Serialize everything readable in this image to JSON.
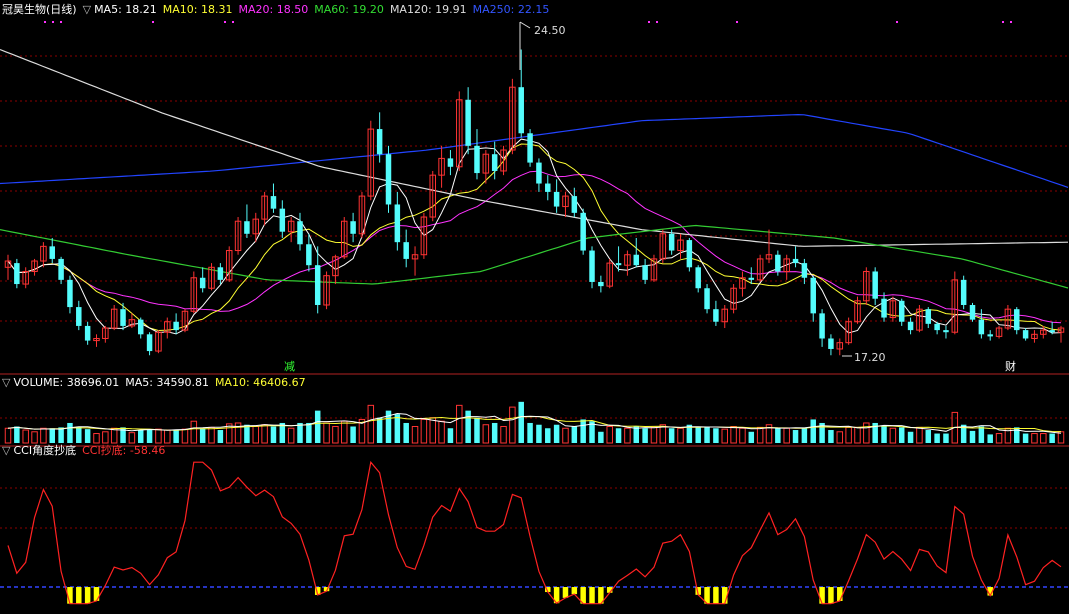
{
  "main": {
    "stock_name": "冠昊生物(日线)",
    "ma_labels": [
      {
        "text": "MA5: 18.21",
        "color": "#ffffff"
      },
      {
        "text": "MA10: 18.31",
        "color": "#ffff33"
      },
      {
        "text": "MA20: 18.50",
        "color": "#ff33ff"
      },
      {
        "text": "MA60: 19.20",
        "color": "#33dd33"
      },
      {
        "text": "MA120: 19.91",
        "color": "#dddddd"
      },
      {
        "text": "MA250: 22.15",
        "color": "#3355ff"
      }
    ],
    "high_label": "24.50",
    "low_label": "17.20",
    "marker_reduce": "减",
    "marker_finance": "财"
  },
  "volume": {
    "title": "VOLUME: 38696.01",
    "ma5": "MA5: 34590.81",
    "ma10": "MA10: 46406.67"
  },
  "cci": {
    "title": "CCI角度抄底",
    "value": "CCI抄底: -58.46"
  },
  "colors": {
    "up": "#ff3333",
    "down": "#54fcfc",
    "ma5": "#ffffff",
    "ma10": "#ffff33",
    "ma20": "#ff33ff",
    "ma60": "#33cc33",
    "ma120": "#dddddd",
    "ma250": "#2244ff",
    "cci_line": "#ff2222",
    "signal": "#ffff00",
    "grid": "#8b0000",
    "baseline": "#3344ff"
  },
  "chart_data": {
    "type": "candlestick",
    "price_range": [
      16.8,
      25.3
    ],
    "candles": [
      [
        19.3,
        19.6,
        19.0,
        19.45
      ],
      [
        19.4,
        19.5,
        18.8,
        18.9
      ],
      [
        18.9,
        19.3,
        18.8,
        19.2
      ],
      [
        19.2,
        19.5,
        19.1,
        19.45
      ],
      [
        19.45,
        19.9,
        19.3,
        19.8
      ],
      [
        19.8,
        20.0,
        19.4,
        19.5
      ],
      [
        19.5,
        19.55,
        18.9,
        19.0
      ],
      [
        19.0,
        19.1,
        18.2,
        18.35
      ],
      [
        18.35,
        18.5,
        17.8,
        17.9
      ],
      [
        17.9,
        18.0,
        17.45,
        17.55
      ],
      [
        17.55,
        17.7,
        17.4,
        17.6
      ],
      [
        17.6,
        17.9,
        17.5,
        17.85
      ],
      [
        17.85,
        18.4,
        17.8,
        18.3
      ],
      [
        18.3,
        18.45,
        17.8,
        17.9
      ],
      [
        17.9,
        18.2,
        17.85,
        18.05
      ],
      [
        18.05,
        18.1,
        17.6,
        17.7
      ],
      [
        17.7,
        17.75,
        17.2,
        17.3
      ],
      [
        17.3,
        17.8,
        17.25,
        17.75
      ],
      [
        17.75,
        18.1,
        17.6,
        18.0
      ],
      [
        18.0,
        18.2,
        17.7,
        17.8
      ],
      [
        17.8,
        18.3,
        17.75,
        18.25
      ],
      [
        18.25,
        19.2,
        18.2,
        19.05
      ],
      [
        19.05,
        19.3,
        18.7,
        18.8
      ],
      [
        18.8,
        19.4,
        18.75,
        19.3
      ],
      [
        19.3,
        19.4,
        18.9,
        19.0
      ],
      [
        19.0,
        19.8,
        18.95,
        19.7
      ],
      [
        19.7,
        20.5,
        19.6,
        20.4
      ],
      [
        20.4,
        20.8,
        20.0,
        20.1
      ],
      [
        20.1,
        20.6,
        19.9,
        20.45
      ],
      [
        20.45,
        21.1,
        20.3,
        21.0
      ],
      [
        21.0,
        21.3,
        20.6,
        20.7
      ],
      [
        20.7,
        20.9,
        20.0,
        20.15
      ],
      [
        20.15,
        20.5,
        19.9,
        20.4
      ],
      [
        20.4,
        20.6,
        19.7,
        19.85
      ],
      [
        19.85,
        20.1,
        19.2,
        19.35
      ],
      [
        19.35,
        19.8,
        18.2,
        18.4
      ],
      [
        18.4,
        19.2,
        18.3,
        19.1
      ],
      [
        19.1,
        19.6,
        18.9,
        19.55
      ],
      [
        19.55,
        20.5,
        19.5,
        20.4
      ],
      [
        20.4,
        20.6,
        19.9,
        20.1
      ],
      [
        20.1,
        21.1,
        20.0,
        21.0
      ],
      [
        21.0,
        22.8,
        20.9,
        22.6
      ],
      [
        22.6,
        23.0,
        21.8,
        22.0
      ],
      [
        22.0,
        22.2,
        20.6,
        20.8
      ],
      [
        20.8,
        21.1,
        19.7,
        19.9
      ],
      [
        19.9,
        20.2,
        19.3,
        19.5
      ],
      [
        19.5,
        19.8,
        19.1,
        19.6
      ],
      [
        19.6,
        20.6,
        19.5,
        20.5
      ],
      [
        20.5,
        21.6,
        20.4,
        21.5
      ],
      [
        21.5,
        22.2,
        21.2,
        21.9
      ],
      [
        21.9,
        22.1,
        21.5,
        21.7
      ],
      [
        21.7,
        23.5,
        21.6,
        23.3
      ],
      [
        23.3,
        23.6,
        22.0,
        22.2
      ],
      [
        22.2,
        22.6,
        21.4,
        21.55
      ],
      [
        21.55,
        22.1,
        21.3,
        22.0
      ],
      [
        22.0,
        22.3,
        21.4,
        21.6
      ],
      [
        21.6,
        22.2,
        21.5,
        22.1
      ],
      [
        22.1,
        23.8,
        22.0,
        23.6
      ],
      [
        23.6,
        24.5,
        22.4,
        22.5
      ],
      [
        22.5,
        22.6,
        21.7,
        21.8
      ],
      [
        21.8,
        21.9,
        21.1,
        21.3
      ],
      [
        21.3,
        21.5,
        20.9,
        21.1
      ],
      [
        21.1,
        21.4,
        20.6,
        20.75
      ],
      [
        20.75,
        21.1,
        20.5,
        21.0
      ],
      [
        21.0,
        21.2,
        20.5,
        20.6
      ],
      [
        20.6,
        20.7,
        19.6,
        19.7
      ],
      [
        19.7,
        19.8,
        18.8,
        18.95
      ],
      [
        18.95,
        19.1,
        18.7,
        18.85
      ],
      [
        18.85,
        19.5,
        18.8,
        19.4
      ],
      [
        19.4,
        19.8,
        19.2,
        19.35
      ],
      [
        19.35,
        19.7,
        19.1,
        19.6
      ],
      [
        19.6,
        20.0,
        19.3,
        19.35
      ],
      [
        19.35,
        19.5,
        18.9,
        19.0
      ],
      [
        19.0,
        19.6,
        18.95,
        19.5
      ],
      [
        19.5,
        20.2,
        19.4,
        20.1
      ],
      [
        20.1,
        20.2,
        19.6,
        19.7
      ],
      [
        19.7,
        20.1,
        19.5,
        19.95
      ],
      [
        19.95,
        20.0,
        19.2,
        19.3
      ],
      [
        19.3,
        19.35,
        18.7,
        18.8
      ],
      [
        18.8,
        18.9,
        18.2,
        18.3
      ],
      [
        18.3,
        18.5,
        17.9,
        18.0
      ],
      [
        18.0,
        18.4,
        17.85,
        18.3
      ],
      [
        18.3,
        18.9,
        18.2,
        18.8
      ],
      [
        18.8,
        19.2,
        18.6,
        19.05
      ],
      [
        19.05,
        19.3,
        18.9,
        19.0
      ],
      [
        19.0,
        19.6,
        18.95,
        19.5
      ],
      [
        19.5,
        20.2,
        19.4,
        19.6
      ],
      [
        19.6,
        19.7,
        19.1,
        19.2
      ],
      [
        19.2,
        19.6,
        19.0,
        19.5
      ],
      [
        19.5,
        19.8,
        19.3,
        19.4
      ],
      [
        19.4,
        19.5,
        18.9,
        19.05
      ],
      [
        19.05,
        19.1,
        18.0,
        18.2
      ],
      [
        18.2,
        18.3,
        17.4,
        17.6
      ],
      [
        17.6,
        17.7,
        17.2,
        17.35
      ],
      [
        17.35,
        17.6,
        17.2,
        17.5
      ],
      [
        17.5,
        18.1,
        17.45,
        18.0
      ],
      [
        18.0,
        18.6,
        17.95,
        18.5
      ],
      [
        18.5,
        19.3,
        18.4,
        19.2
      ],
      [
        19.2,
        19.3,
        18.4,
        18.55
      ],
      [
        18.55,
        18.7,
        18.0,
        18.1
      ],
      [
        18.1,
        18.6,
        18.0,
        18.5
      ],
      [
        18.5,
        18.55,
        17.9,
        18.0
      ],
      [
        18.0,
        18.1,
        17.7,
        17.8
      ],
      [
        17.8,
        18.4,
        17.75,
        18.3
      ],
      [
        18.3,
        18.35,
        17.85,
        17.95
      ],
      [
        17.95,
        18.0,
        17.7,
        17.8
      ],
      [
        17.8,
        17.9,
        17.6,
        17.75
      ],
      [
        17.75,
        19.2,
        17.7,
        19.0
      ],
      [
        19.0,
        19.1,
        18.3,
        18.4
      ],
      [
        18.4,
        18.45,
        18.0,
        18.05
      ],
      [
        18.05,
        18.3,
        17.6,
        17.7
      ],
      [
        17.7,
        17.8,
        17.55,
        17.65
      ],
      [
        17.65,
        17.9,
        17.6,
        17.85
      ],
      [
        17.85,
        18.4,
        17.8,
        18.3
      ],
      [
        18.3,
        18.35,
        17.7,
        17.8
      ],
      [
        17.8,
        17.85,
        17.55,
        17.6
      ],
      [
        17.6,
        17.8,
        17.5,
        17.7
      ],
      [
        17.7,
        17.9,
        17.6,
        17.8
      ],
      [
        17.8,
        18.0,
        17.7,
        17.75
      ],
      [
        17.75,
        17.9,
        17.5,
        17.85
      ]
    ],
    "ma250_anchor": [
      [
        0,
        21.3
      ],
      [
        0.2,
        21.6
      ],
      [
        0.4,
        22.1
      ],
      [
        0.6,
        22.8
      ],
      [
        0.75,
        22.95
      ],
      [
        0.85,
        22.5
      ],
      [
        1.0,
        21.2
      ]
    ],
    "ma120_anchor": [
      [
        0,
        24.5
      ],
      [
        0.15,
        23.0
      ],
      [
        0.3,
        21.7
      ],
      [
        0.45,
        20.9
      ],
      [
        0.6,
        20.2
      ],
      [
        0.75,
        19.8
      ],
      [
        1.0,
        19.9
      ]
    ],
    "ma60_anchor": [
      [
        0,
        20.2
      ],
      [
        0.12,
        19.6
      ],
      [
        0.25,
        19.0
      ],
      [
        0.35,
        18.9
      ],
      [
        0.45,
        19.2
      ],
      [
        0.55,
        20.0
      ],
      [
        0.65,
        20.3
      ],
      [
        0.78,
        20.0
      ],
      [
        0.9,
        19.5
      ],
      [
        1.0,
        18.8
      ]
    ],
    "volume_range": [
      0,
      110000
    ],
    "cci_range": [
      -160,
      210
    ],
    "cci_signal_level": -100
  }
}
